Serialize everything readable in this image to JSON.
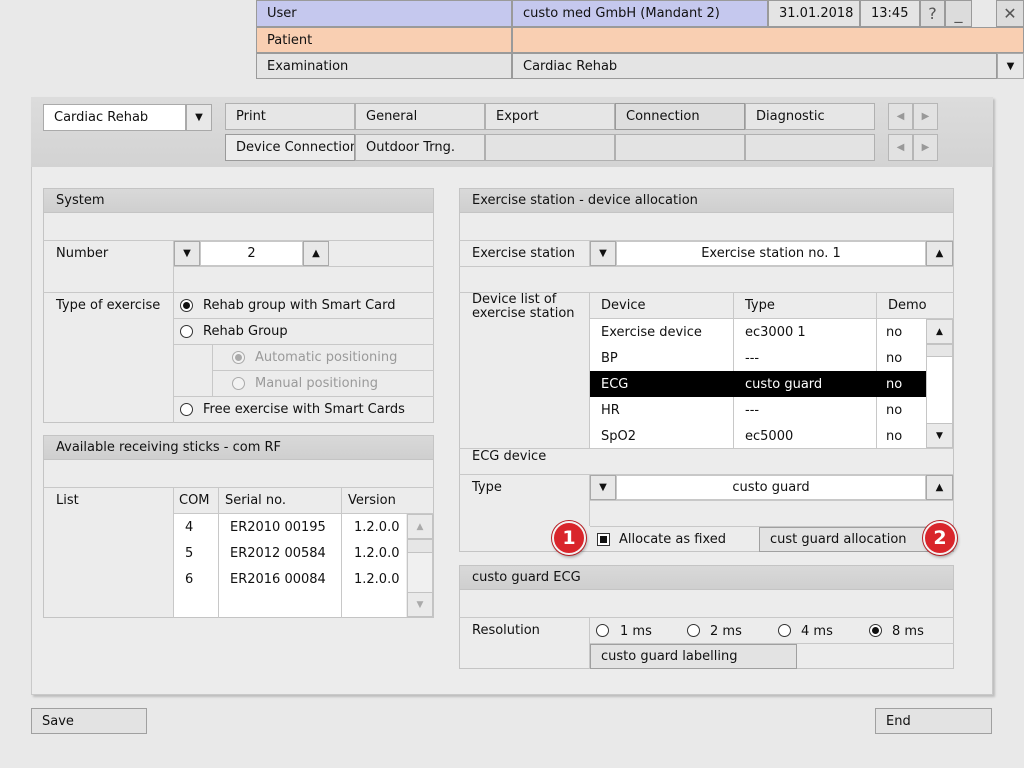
{
  "header": {
    "user_label": "User",
    "company": "custo med GmbH (Mandant 2)",
    "date": "31.01.2018",
    "time": "13:45",
    "help": "?",
    "minimize": "_",
    "close": "✕",
    "patient_label": "Patient",
    "patient_value": "",
    "examination_label": "Examination",
    "examination_value": "Cardiac Rehab"
  },
  "module_select": "Cardiac Rehab",
  "tabs_row1": [
    "Print",
    "General",
    "Export",
    "Connection",
    "Diagnostic"
  ],
  "tabs_row2": [
    "Device Connection",
    "Outdoor Trng."
  ],
  "system": {
    "title": "System",
    "number_label": "Number",
    "number_value": "2",
    "type_label": "Type of exercise",
    "options": [
      "Rehab group with Smart Card",
      "Rehab Group",
      "Automatic positioning",
      "Manual positioning",
      "Free exercise with Smart Cards"
    ]
  },
  "sticks": {
    "title": "Available receiving sticks - com RF",
    "list_label": "List",
    "columns": [
      "COM",
      "Serial no.",
      "Version"
    ],
    "rows": [
      [
        "4",
        "ER2010 00195",
        "1.2.0.0"
      ],
      [
        "5",
        "ER2012 00584",
        "1.2.0.0"
      ],
      [
        "6",
        "ER2016 00084",
        "1.2.0.0"
      ]
    ]
  },
  "allocation": {
    "title": "Exercise station - device allocation",
    "station_label": "Exercise station",
    "station_value": "Exercise station no. 1",
    "device_list_label_1": "Device list of",
    "device_list_label_2": "exercise station",
    "columns": [
      "Device",
      "Type",
      "Demo"
    ],
    "rows": [
      [
        "Exercise device",
        "ec3000 1",
        "no"
      ],
      [
        "BP",
        "---",
        "no"
      ],
      [
        "ECG",
        "custo guard",
        "no"
      ],
      [
        "HR",
        "---",
        "no"
      ],
      [
        "SpO2",
        "ec5000",
        "no"
      ]
    ],
    "ecg_device_label": "ECG device",
    "type_label": "Type",
    "type_value": "custo guard",
    "allocate_fixed": "Allocate as fixed",
    "allocation_button": "cust guard allocation",
    "badge_1": "1",
    "badge_2": "2"
  },
  "ecg": {
    "title": "custo guard ECG",
    "resolution_label": "Resolution",
    "options": [
      "1 ms",
      "2 ms",
      "4 ms",
      "8 ms"
    ],
    "labelling_button": "custo guard labelling"
  },
  "footer": {
    "save": "Save",
    "end": "End"
  }
}
